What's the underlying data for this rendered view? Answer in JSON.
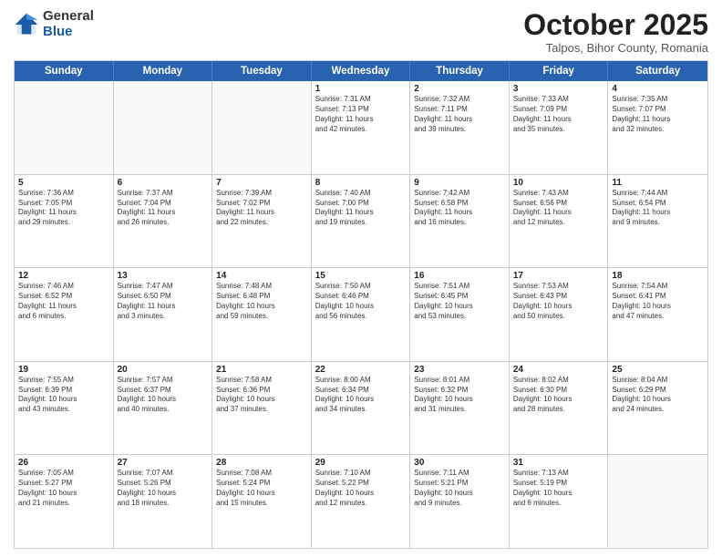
{
  "logo": {
    "general": "General",
    "blue": "Blue"
  },
  "header": {
    "month": "October 2025",
    "location": "Talpos, Bihor County, Romania"
  },
  "weekdays": [
    "Sunday",
    "Monday",
    "Tuesday",
    "Wednesday",
    "Thursday",
    "Friday",
    "Saturday"
  ],
  "weeks": [
    [
      {
        "day": "",
        "content": ""
      },
      {
        "day": "",
        "content": ""
      },
      {
        "day": "",
        "content": ""
      },
      {
        "day": "1",
        "content": "Sunrise: 7:31 AM\nSunset: 7:13 PM\nDaylight: 11 hours\nand 42 minutes."
      },
      {
        "day": "2",
        "content": "Sunrise: 7:32 AM\nSunset: 7:11 PM\nDaylight: 11 hours\nand 39 minutes."
      },
      {
        "day": "3",
        "content": "Sunrise: 7:33 AM\nSunset: 7:09 PM\nDaylight: 11 hours\nand 35 minutes."
      },
      {
        "day": "4",
        "content": "Sunrise: 7:35 AM\nSunset: 7:07 PM\nDaylight: 11 hours\nand 32 minutes."
      }
    ],
    [
      {
        "day": "5",
        "content": "Sunrise: 7:36 AM\nSunset: 7:05 PM\nDaylight: 11 hours\nand 29 minutes."
      },
      {
        "day": "6",
        "content": "Sunrise: 7:37 AM\nSunset: 7:04 PM\nDaylight: 11 hours\nand 26 minutes."
      },
      {
        "day": "7",
        "content": "Sunrise: 7:39 AM\nSunset: 7:02 PM\nDaylight: 11 hours\nand 22 minutes."
      },
      {
        "day": "8",
        "content": "Sunrise: 7:40 AM\nSunset: 7:00 PM\nDaylight: 11 hours\nand 19 minutes."
      },
      {
        "day": "9",
        "content": "Sunrise: 7:42 AM\nSunset: 6:58 PM\nDaylight: 11 hours\nand 16 minutes."
      },
      {
        "day": "10",
        "content": "Sunrise: 7:43 AM\nSunset: 6:56 PM\nDaylight: 11 hours\nand 12 minutes."
      },
      {
        "day": "11",
        "content": "Sunrise: 7:44 AM\nSunset: 6:54 PM\nDaylight: 11 hours\nand 9 minutes."
      }
    ],
    [
      {
        "day": "12",
        "content": "Sunrise: 7:46 AM\nSunset: 6:52 PM\nDaylight: 11 hours\nand 6 minutes."
      },
      {
        "day": "13",
        "content": "Sunrise: 7:47 AM\nSunset: 6:50 PM\nDaylight: 11 hours\nand 3 minutes."
      },
      {
        "day": "14",
        "content": "Sunrise: 7:48 AM\nSunset: 6:48 PM\nDaylight: 10 hours\nand 59 minutes."
      },
      {
        "day": "15",
        "content": "Sunrise: 7:50 AM\nSunset: 6:46 PM\nDaylight: 10 hours\nand 56 minutes."
      },
      {
        "day": "16",
        "content": "Sunrise: 7:51 AM\nSunset: 6:45 PM\nDaylight: 10 hours\nand 53 minutes."
      },
      {
        "day": "17",
        "content": "Sunrise: 7:53 AM\nSunset: 6:43 PM\nDaylight: 10 hours\nand 50 minutes."
      },
      {
        "day": "18",
        "content": "Sunrise: 7:54 AM\nSunset: 6:41 PM\nDaylight: 10 hours\nand 47 minutes."
      }
    ],
    [
      {
        "day": "19",
        "content": "Sunrise: 7:55 AM\nSunset: 6:39 PM\nDaylight: 10 hours\nand 43 minutes."
      },
      {
        "day": "20",
        "content": "Sunrise: 7:57 AM\nSunset: 6:37 PM\nDaylight: 10 hours\nand 40 minutes."
      },
      {
        "day": "21",
        "content": "Sunrise: 7:58 AM\nSunset: 6:36 PM\nDaylight: 10 hours\nand 37 minutes."
      },
      {
        "day": "22",
        "content": "Sunrise: 8:00 AM\nSunset: 6:34 PM\nDaylight: 10 hours\nand 34 minutes."
      },
      {
        "day": "23",
        "content": "Sunrise: 8:01 AM\nSunset: 6:32 PM\nDaylight: 10 hours\nand 31 minutes."
      },
      {
        "day": "24",
        "content": "Sunrise: 8:02 AM\nSunset: 6:30 PM\nDaylight: 10 hours\nand 28 minutes."
      },
      {
        "day": "25",
        "content": "Sunrise: 8:04 AM\nSunset: 6:29 PM\nDaylight: 10 hours\nand 24 minutes."
      }
    ],
    [
      {
        "day": "26",
        "content": "Sunrise: 7:05 AM\nSunset: 5:27 PM\nDaylight: 10 hours\nand 21 minutes."
      },
      {
        "day": "27",
        "content": "Sunrise: 7:07 AM\nSunset: 5:26 PM\nDaylight: 10 hours\nand 18 minutes."
      },
      {
        "day": "28",
        "content": "Sunrise: 7:08 AM\nSunset: 5:24 PM\nDaylight: 10 hours\nand 15 minutes."
      },
      {
        "day": "29",
        "content": "Sunrise: 7:10 AM\nSunset: 5:22 PM\nDaylight: 10 hours\nand 12 minutes."
      },
      {
        "day": "30",
        "content": "Sunrise: 7:11 AM\nSunset: 5:21 PM\nDaylight: 10 hours\nand 9 minutes."
      },
      {
        "day": "31",
        "content": "Sunrise: 7:13 AM\nSunset: 5:19 PM\nDaylight: 10 hours\nand 6 minutes."
      },
      {
        "day": "",
        "content": ""
      }
    ]
  ]
}
